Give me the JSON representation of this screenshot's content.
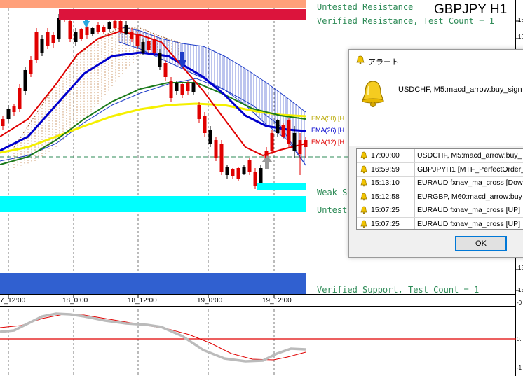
{
  "chart": {
    "symbol": "GBPJPY H1",
    "zone_labels": {
      "untested_resistance": "Untested Resistance",
      "verified_resistance": "Verified Resistance, Test Count = 1",
      "weak_support": "Weak S",
      "untested_support": "Untest",
      "verified_support": "Verified Support, Test Count = 1"
    },
    "ema_labels": {
      "ema50": "EMA(50) [H",
      "ema26": "EMA(26) [H",
      "ema12": "EMA(12) [H"
    },
    "time_labels": [
      "7_12:00",
      "18_0:00",
      "18_12:00",
      "19_0:00",
      "19_12:00"
    ],
    "price_labels": [
      "16",
      "16",
      "15",
      "15",
      "15",
      "15",
      "15",
      "15",
      "15",
      "15",
      "15"
    ],
    "indicator_price_labels": [
      "-0",
      "0.",
      "-1"
    ],
    "colors": {
      "resistance_untested": "#ffa07a",
      "resistance_verified": "#dc143c",
      "support_weak": "#00ffff",
      "support_verified": "#3060d0",
      "zone_text": "#2e8b57",
      "ema12": "#e00000",
      "ema26": "#0000cd",
      "ema50": "#1a7a1a",
      "ema_slow": "#f5f000",
      "bull_candle": "#e00000",
      "bear_candle": "#000000"
    }
  },
  "alert_dialog": {
    "title": "アラート",
    "message": "USDCHF, M5:macd_arrow:buy_sign",
    "rows": [
      {
        "time": "17:00:00",
        "message": "USDCHF, M5:macd_arrow:buy_"
      },
      {
        "time": "16:59:59",
        "message": "GBPJPYH1 [MTF_PerfectOrder_"
      },
      {
        "time": "15:13:10",
        "message": "EURAUD fxnav_ma_cross [Dow"
      },
      {
        "time": "15:12:58",
        "message": "EURGBP, M60:macd_arrow:buy"
      },
      {
        "time": "15:07:25",
        "message": "EURAUD fxnav_ma_cross [UP]"
      },
      {
        "time": "15:07:25",
        "message": "EURAUD fxnav_ma_cross [UP]"
      }
    ],
    "ok_label": "OK",
    "icons": {
      "title": "bell-icon",
      "message": "bell-large-icon",
      "row": "bell-small-icon"
    }
  }
}
